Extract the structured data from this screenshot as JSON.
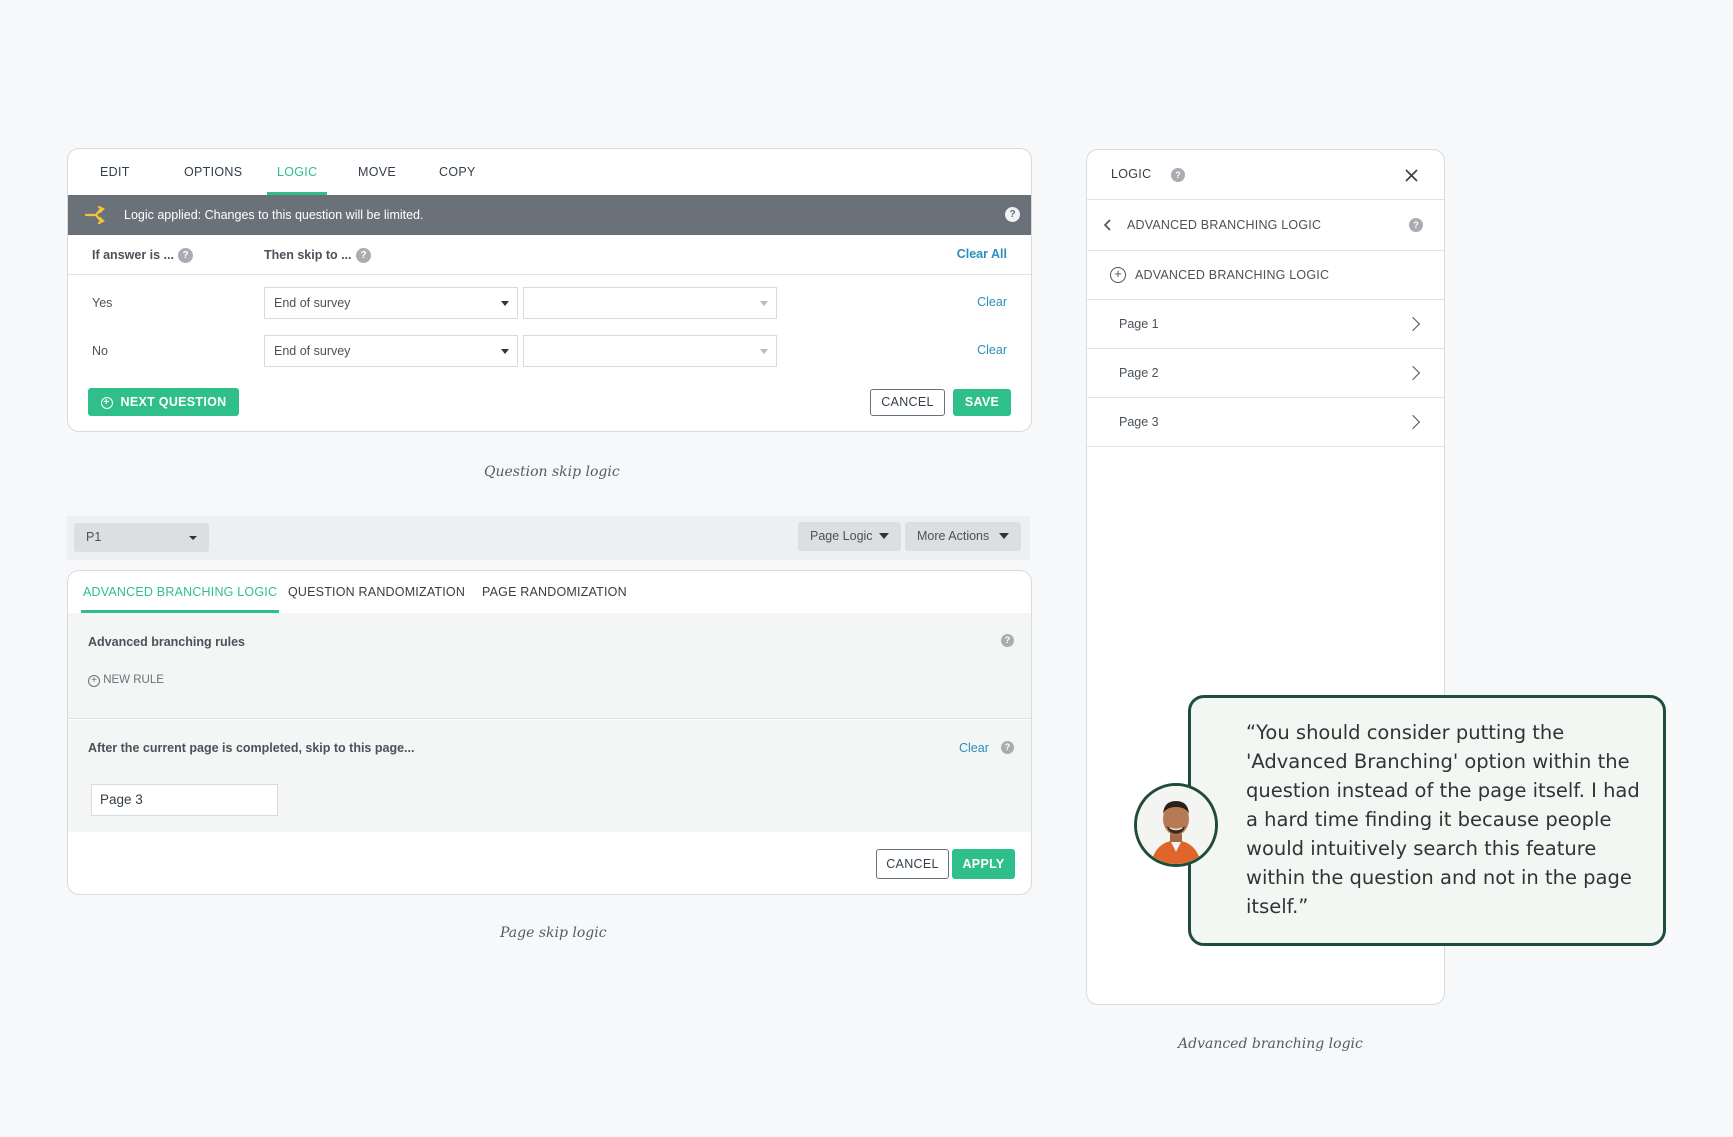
{
  "question_logic": {
    "tabs": [
      "EDIT",
      "OPTIONS",
      "LOGIC",
      "MOVE",
      "COPY"
    ],
    "active_tab": "LOGIC",
    "banner_text": "Logic applied: Changes to this question will be limited.",
    "header_if": "If answer is ...",
    "header_then": "Then skip to ...",
    "clear_all": "Clear All",
    "rows": [
      {
        "answer": "Yes",
        "skip_to": "End of survey",
        "second": "",
        "clear": "Clear"
      },
      {
        "answer": "No",
        "skip_to": "End of survey",
        "second": "",
        "clear": "Clear"
      }
    ],
    "next_question": "NEXT QUESTION",
    "cancel": "CANCEL",
    "save": "SAVE",
    "caption": "Question skip logic"
  },
  "page_logic": {
    "page_select": "P1",
    "page_logic_btn": "Page Logic",
    "more_actions_btn": "More Actions",
    "tabs": [
      "ADVANCED BRANCHING LOGIC",
      "QUESTION RANDOMIZATION",
      "PAGE RANDOMIZATION"
    ],
    "rules_title": "Advanced branching rules",
    "new_rule": "NEW RULE",
    "after_text": "After the current page is completed, skip to this page...",
    "clear": "Clear",
    "page_value": "Page 3",
    "cancel": "CANCEL",
    "apply": "APPLY",
    "caption": "Page skip logic"
  },
  "side_panel": {
    "title": "LOGIC",
    "sub_title": "ADVANCED BRANCHING LOGIC",
    "add_label": "ADVANCED BRANCHING LOGIC",
    "pages": [
      "Page 1",
      "Page 2",
      "Page 3"
    ],
    "caption": "Advanced branching logic"
  },
  "quote": {
    "text": "“You should consider putting the 'Advanced Branching' option within the question instead of the page itself. I had a hard time finding it because people would intuitively search this feature within the question and not in the page itself.”"
  },
  "colors": {
    "accent": "#2fbf8a",
    "banner": "#6b7179",
    "link": "#2a8fbd",
    "quote_border": "#1f4d3c"
  }
}
